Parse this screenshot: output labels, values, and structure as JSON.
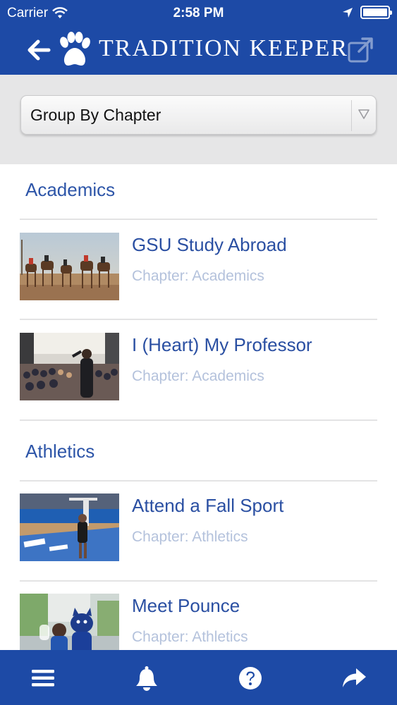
{
  "status_bar": {
    "carrier": "Carrier",
    "time": "2:58 PM"
  },
  "header": {
    "title": "TRADITION KEEPER"
  },
  "filter": {
    "selected_option": "Group By Chapter"
  },
  "sections": [
    {
      "name": "Academics",
      "items": [
        {
          "title": "GSU Study Abroad",
          "chapter": "Chapter: Academics"
        },
        {
          "title": "I (Heart) My Professor",
          "chapter": "Chapter: Academics"
        }
      ]
    },
    {
      "name": "Athletics",
      "items": [
        {
          "title": "Attend a Fall Sport",
          "chapter": "Chapter: Athletics"
        },
        {
          "title": "Meet Pounce",
          "chapter": "Chapter: Athletics"
        }
      ]
    }
  ],
  "tabbar": {
    "icons": [
      "menu-icon",
      "bell-icon",
      "help-icon",
      "share-icon"
    ]
  },
  "colors": {
    "brand_blue": "#1d4aa6",
    "title_blue": "#2a4fa2",
    "subtitle_gray": "#b4c2dc"
  }
}
